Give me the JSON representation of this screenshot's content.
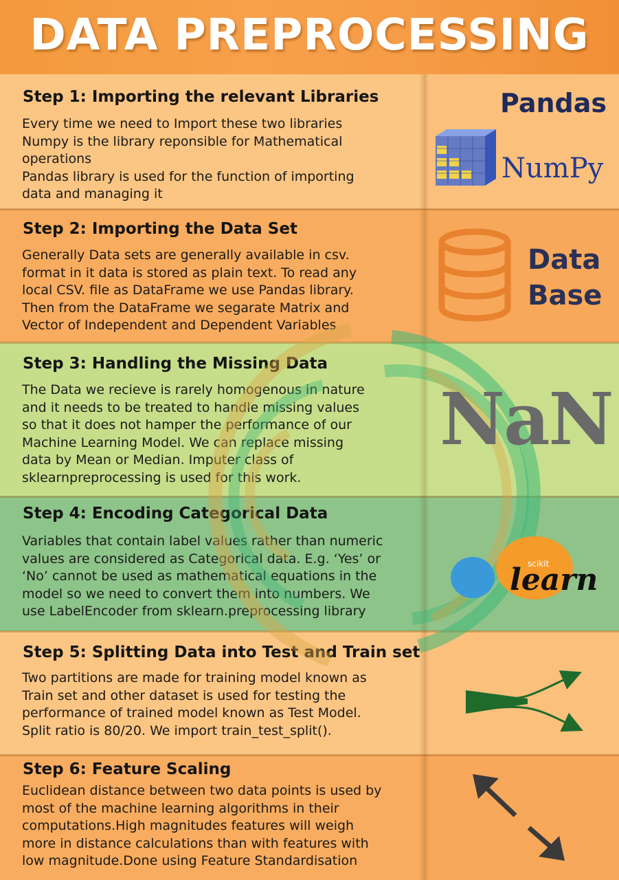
{
  "header": {
    "title": "DATA PREPROCESSING"
  },
  "steps": [
    {
      "title": "Step 1: Importing the relevant Libraries",
      "body": "Every time we need to Import these two libraries\nNumpy is the library reponsible for Mathematical\noperations\nPandas library is used for the function of importing\ndata and managing it"
    },
    {
      "title": "Step 2: Importing the Data Set",
      "body": "Generally Data sets are generally available in csv.\nformat in it data is stored as plain text. To read any\nlocal CSV. file as DataFrame we use Pandas library.\nThen from the DataFrame we segarate Matrix and\nVector of Independent and Dependent Variables"
    },
    {
      "title": "Step 3: Handling the Missing Data",
      "body": "The Data we recieve is rarely homogenous in nature\nand it needs to be treated to handle missing values\nso that it does not hamper the performance of our\nMachine Learning Model. We can replace missing\ndata by Mean or Median. Imputer class of\nsklearnpreprocessing is used for this work."
    },
    {
      "title": "Step 4: Encoding Categorical Data",
      "body": "Variables that contain label values rather than numeric\nvalues are considered as Categorical data. E.g. ‘Yes’ or\n‘No’ cannot be used as mathematical equations in the\nmodel so we need to convert them into numbers. We\nuse LabelEncoder from sklearn.preprocessing library"
    },
    {
      "title": "Step 5: Splitting Data into Test and Train set",
      "body": "Two partitions are made for training model known as\nTrain set and other dataset is used for testing the\nperformance of trained model known as Test Model.\nSplit ratio is 80/20. We import train_test_split()."
    },
    {
      "title": "Step 6: Feature Scaling",
      "body": "Euclidean distance between two data points is used by\nmost of the machine learning algorithms in their\ncomputations.High magnitudes features will weigh\nmore in distance calculations than with features with\nlow magnitude.Done using Feature Standardisation"
    }
  ],
  "side_labels": {
    "pandas": "Pandas",
    "numpy": "NumPy",
    "database_line1": "Data",
    "database_line2": "Base",
    "nan": "NaN",
    "scikit": "scikit",
    "learn": "learn"
  },
  "icons": {
    "numpy": "numpy-cube-logo",
    "database": "database-cylinder-icon",
    "sklearn": "scikit-learn-logo",
    "split": "split-arrows-icon",
    "scaling": "diagonal-double-arrow-icon"
  },
  "colors": {
    "header": "#f59b45",
    "section_light_orange": "#fbc583",
    "section_orange": "#f8ac5f",
    "section_light_green": "#c6de8a",
    "section_green": "#8dc489",
    "pandas_navy": "#1f2a5a",
    "numpy_blue": "#243a8f",
    "database_orange": "#e8822e",
    "split_arrow_green": "#1f6b2c",
    "scaling_arrow_gray": "#3a3a3a"
  }
}
